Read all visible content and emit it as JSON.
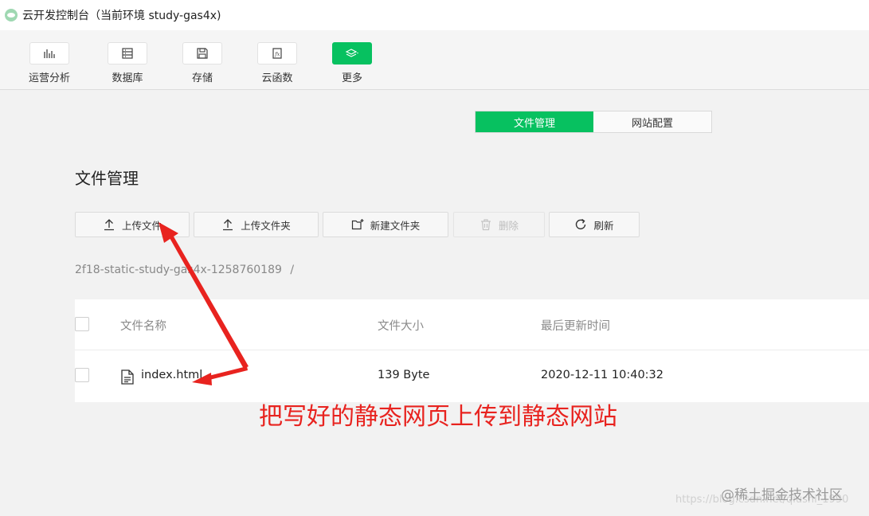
{
  "window": {
    "title": "云开发控制台（当前环境 study-gas4x)"
  },
  "toolbar": {
    "items": [
      {
        "label": "运营分析",
        "icon": "bar-chart-icon"
      },
      {
        "label": "数据库",
        "icon": "database-icon"
      },
      {
        "label": "存储",
        "icon": "storage-icon"
      },
      {
        "label": "云函数",
        "icon": "function-icon"
      },
      {
        "label": "更多",
        "icon": "layers-icon"
      }
    ],
    "accent": "#07c160"
  },
  "tabs": {
    "file_manage": "文件管理",
    "site_config": "网站配置",
    "active": "文件管理"
  },
  "page": {
    "title": "文件管理"
  },
  "actions": {
    "upload_file": "上传文件",
    "upload_folder": "上传文件夹",
    "new_folder": "新建文件夹",
    "delete": "删除",
    "refresh": "刷新"
  },
  "breadcrumb": {
    "path": "2f18-static-study-gas4x-1258760189",
    "separator": "/"
  },
  "table": {
    "columns": [
      "文件名称",
      "文件大小",
      "最后更新时间"
    ],
    "rows": [
      {
        "name": "index.html",
        "size": "139 Byte",
        "updated": "2020-12-11 10:40:32"
      }
    ]
  },
  "annotation": {
    "text": "把写好的静态网页上传到静态网站",
    "color": "#e8231f"
  },
  "watermark": {
    "text": "@稀土掘金技术社区",
    "url": "https://blog.csdn.net/qiushi_1990"
  }
}
